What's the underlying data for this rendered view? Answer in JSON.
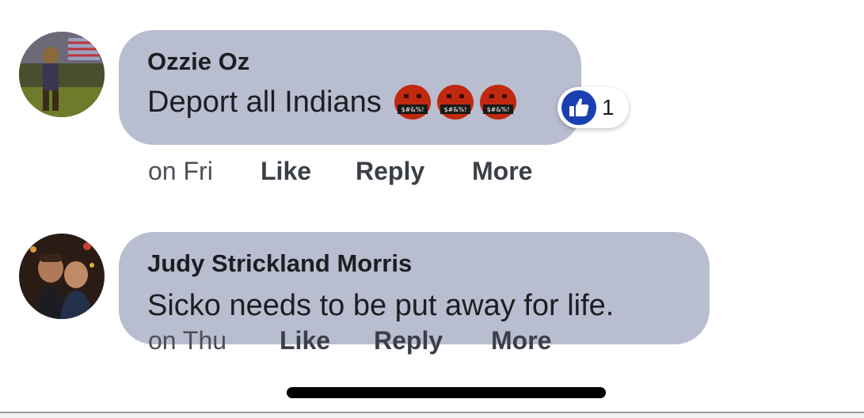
{
  "comments": [
    {
      "author": "Ozzie Oz",
      "text": "Deport all Indians",
      "emojis": [
        "angry-cursing-face-icon",
        "angry-cursing-face-icon",
        "angry-cursing-face-icon"
      ],
      "reaction_icon": "like-thumb-icon",
      "reaction_count": "1",
      "timestamp": "on Fri",
      "actions": {
        "like": "Like",
        "reply": "Reply",
        "more": "More"
      }
    },
    {
      "author": "Judy Strickland Morris",
      "text": "Sicko needs to be put away for life.",
      "timestamp": "on Thu",
      "actions": {
        "like": "Like",
        "reply": "Reply",
        "more": "More"
      }
    }
  ],
  "colors": {
    "bubble": "#b8bed0",
    "text": "#1c1e21",
    "like_badge": "#1a3fb0",
    "emoji": "#c0290f"
  }
}
